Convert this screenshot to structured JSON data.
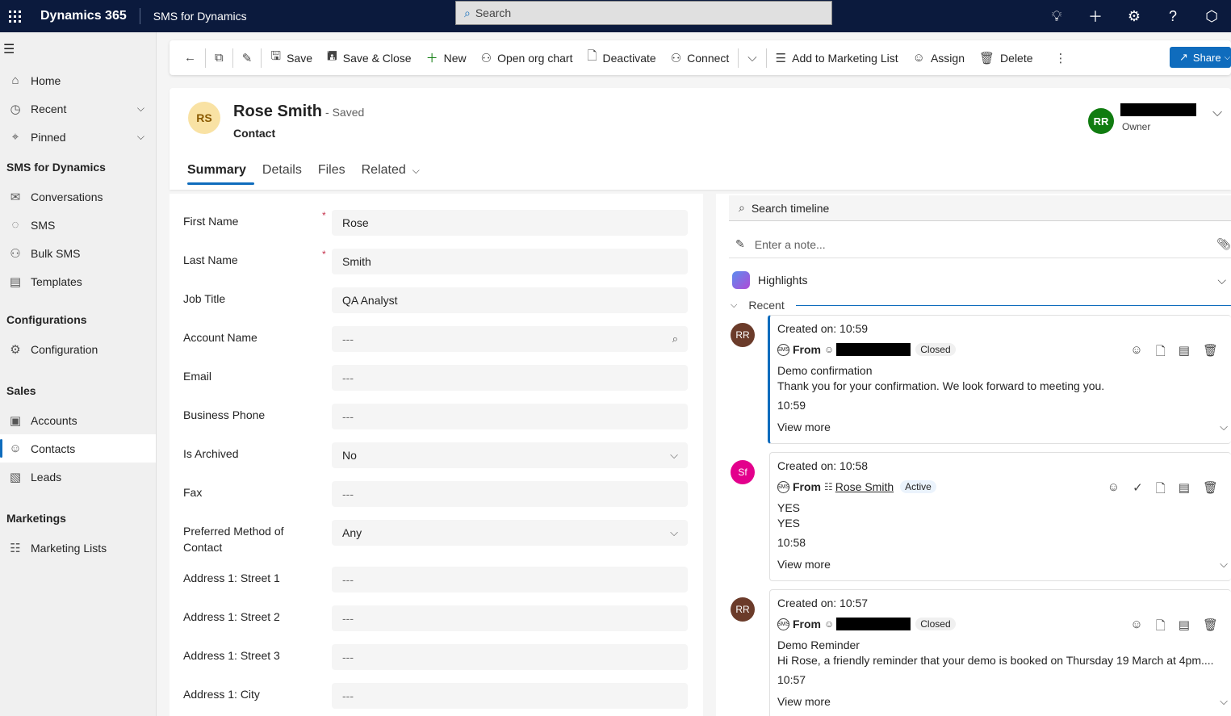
{
  "topbar": {
    "brand": "Dynamics 365",
    "app_name": "SMS for Dynamics",
    "search_placeholder": "Search"
  },
  "sidebar": {
    "items_top": [
      {
        "label": "Home",
        "icon": "home-icon"
      },
      {
        "label": "Recent",
        "icon": "clock-icon"
      },
      {
        "label": "Pinned",
        "icon": "pin-icon"
      }
    ],
    "sections": [
      {
        "title": "SMS for Dynamics",
        "items": [
          {
            "label": "Conversations"
          },
          {
            "label": "SMS"
          },
          {
            "label": "Bulk SMS"
          },
          {
            "label": "Templates"
          }
        ]
      },
      {
        "title": "Configurations",
        "items": [
          {
            "label": "Configuration"
          }
        ]
      },
      {
        "title": "Sales",
        "items": [
          {
            "label": "Accounts"
          },
          {
            "label": "Contacts"
          },
          {
            "label": "Leads"
          }
        ]
      },
      {
        "title": "Marketings",
        "items": [
          {
            "label": "Marketing Lists"
          }
        ]
      }
    ]
  },
  "commandbar": {
    "save": "Save",
    "save_close": "Save & Close",
    "new": "New",
    "org_chart": "Open org chart",
    "deactivate": "Deactivate",
    "connect": "Connect",
    "add_marketing": "Add to Marketing List",
    "assign": "Assign",
    "delete": "Delete",
    "share": "Share"
  },
  "record": {
    "initials": "RS",
    "name": "Rose Smith",
    "status": "- Saved",
    "type": "Contact",
    "owner_initials": "RR",
    "owner_label": "Owner",
    "tabs": [
      "Summary",
      "Details",
      "Files",
      "Related"
    ]
  },
  "form": {
    "fields": [
      {
        "label": "First Name",
        "value": "Rose",
        "required": "*"
      },
      {
        "label": "Last Name",
        "value": "Smith",
        "required": "*"
      },
      {
        "label": "Job Title",
        "value": "QA Analyst"
      },
      {
        "label": "Account Name",
        "value": "---"
      },
      {
        "label": "Email",
        "value": "---"
      },
      {
        "label": "Business Phone",
        "value": "---"
      },
      {
        "label": "Is Archived",
        "value": "No"
      },
      {
        "label": "Fax",
        "value": "---"
      },
      {
        "label": "Preferred Method of Contact",
        "value": "Any"
      },
      {
        "label": "Address 1: Street 1",
        "value": "---"
      },
      {
        "label": "Address 1: Street 2",
        "value": "---"
      },
      {
        "label": "Address 1: Street 3",
        "value": "---"
      },
      {
        "label": "Address 1: City",
        "value": "---"
      }
    ]
  },
  "timeline": {
    "search_placeholder": "Search timeline",
    "note_placeholder": "Enter a note...",
    "highlights": "Highlights",
    "recent": "Recent",
    "items": [
      {
        "avatar": "RR",
        "avatar_color": "#6b3b2a",
        "created": "Created on: 10:59",
        "from": "From",
        "status": "Closed",
        "subject": "Demo confirmation",
        "body": "Thank you for your confirmation. We look forward to meeting you.",
        "time": "10:59",
        "view_more": "View more"
      },
      {
        "avatar": "Sf",
        "avatar_color": "#e3008c",
        "created": "Created on: 10:58",
        "from": "From",
        "sender": "Rose Smith",
        "status": "Active",
        "subject": "YES",
        "body": "YES",
        "time": "10:58",
        "view_more": "View more"
      },
      {
        "avatar": "RR",
        "avatar_color": "#6b3b2a",
        "created": "Created on: 10:57",
        "from": "From",
        "status": "Closed",
        "subject": "Demo Reminder",
        "body": "Hi Rose, a friendly reminder that your demo is booked on Thursday 19 March at 4pm....",
        "time": "10:57",
        "view_more": "View more"
      }
    ]
  },
  "colors": {
    "accent": "#0f6cbd",
    "topbar": "#0b1a3d"
  }
}
